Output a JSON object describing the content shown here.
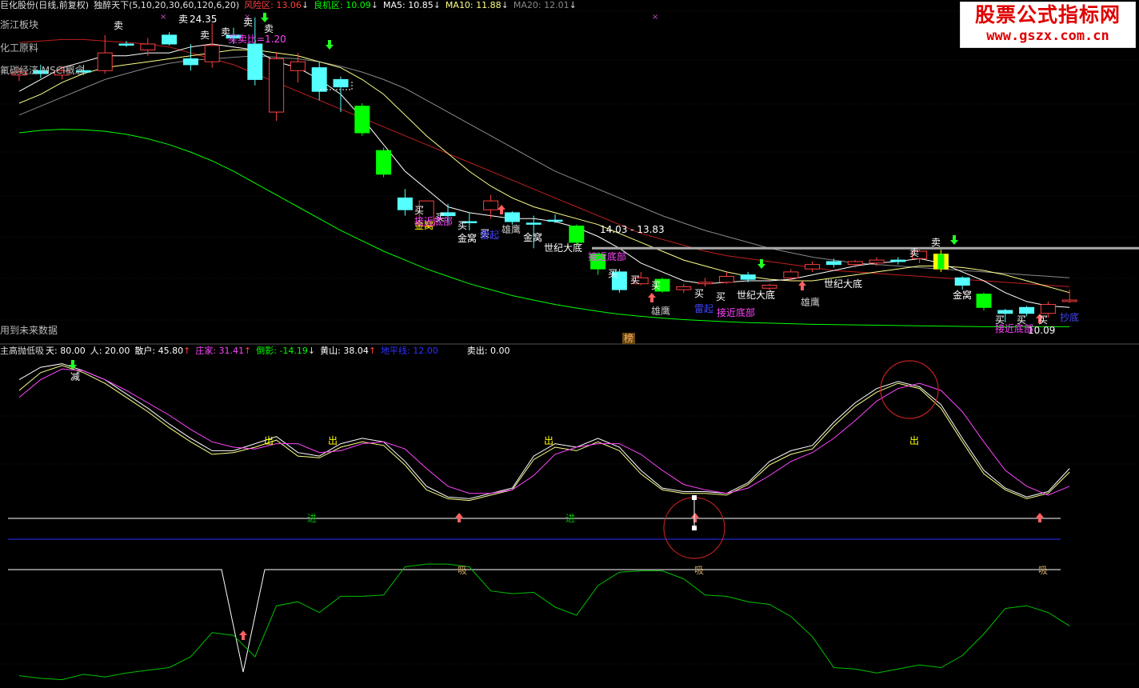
{
  "header_main": {
    "title": "巨化股份(日线,前复权)",
    "indicator": "独醉天下(5,10,20,30,60,120,6,20)",
    "risk_label": "风险区: 13.06",
    "chance_label": "良机区: 10.09",
    "ma5": "MA5: 10.85",
    "ma10": "MA10: 11.88",
    "ma20": "MA20: 12.01",
    "down_arrow": "↓"
  },
  "sidebar": {
    "items": [
      "浙江板块",
      "化工原料",
      "氟碳经济 MSCI概念"
    ],
    "future_data": "用到未来数据"
  },
  "logo": {
    "cn": "股票公式指标网",
    "url": "www.gszx.com.cn"
  },
  "header_sub": {
    "name": "主高抛低吸",
    "tian": "天: 80.00",
    "ren": "人: 20.00",
    "sanhu": "散户: 45.80",
    "zhuangjia": "庄家: 31.41",
    "daoying": "倒影: -14.19",
    "huangshan": "黄山: 38.04",
    "dipingxian": "地平线: 12.00",
    "maichu": "卖出: 0.00",
    "up_arrow": "↑",
    "down_arrow": "↓"
  },
  "main_labels": {
    "high_price": "24.35",
    "buy_ratio": "买卖比=1.20",
    "range": "14.03 - 13.83",
    "last_price": "10.09",
    "bang": "榜"
  },
  "signals": {
    "mai_chu": "卖",
    "mai_ru": "买",
    "jin_wo": "金窝",
    "jie_jin_di_bu": "接近底部",
    "xiong_ying": "雄鹰",
    "shi_ji_da_di": "世纪大底",
    "lei_qi": "雷起",
    "jian": "减",
    "chu": "出",
    "jin": "进",
    "xi": "吸",
    "zhao_zhong": "抄底"
  },
  "colors": {
    "background": "#000000",
    "up_candle": "#ff4040",
    "down_cyan": "#55ffff",
    "down_green": "#00ff00",
    "risk": "#ff4040",
    "chance": "#00ff00",
    "ma20": "#888888",
    "magenta": "#ff44ff",
    "horizon": "#3030ff"
  },
  "chart_data": [
    {
      "type": "candlestick",
      "title": "巨化股份(日线,前复权)",
      "candles": [
        {
          "o": 11.95,
          "c": 12.05,
          "h": 12.2,
          "l": 11.75,
          "col": "red"
        },
        {
          "o": 12.1,
          "c": 12.0,
          "h": 12.3,
          "l": 11.85,
          "col": "cyan"
        },
        {
          "o": 11.95,
          "c": 12.1,
          "h": 12.25,
          "l": 11.8,
          "col": "red"
        },
        {
          "o": 12.05,
          "c": 12.1,
          "h": 12.3,
          "l": 11.95,
          "col": "cyan"
        },
        {
          "o": 12.1,
          "c": 12.7,
          "h": 13.3,
          "l": 12.0,
          "col": "red"
        },
        {
          "o": 13.0,
          "c": 13.0,
          "h": 13.1,
          "l": 12.9,
          "col": "cyan"
        },
        {
          "o": 12.8,
          "c": 13.0,
          "h": 13.2,
          "l": 12.6,
          "col": "red"
        },
        {
          "o": 13.3,
          "c": 13.0,
          "h": 13.4,
          "l": 12.95,
          "col": "cyan"
        },
        {
          "o": 12.5,
          "c": 12.3,
          "h": 13.0,
          "l": 12.1,
          "col": "cyan"
        },
        {
          "o": 12.4,
          "c": 12.95,
          "h": 13.7,
          "l": 12.2,
          "col": "red"
        },
        {
          "o": 13.3,
          "c": 13.2,
          "h": 13.55,
          "l": 13.0,
          "col": "cyan"
        },
        {
          "o": 13.0,
          "c": 11.8,
          "h": 13.9,
          "l": 11.6,
          "col": "cyan"
        },
        {
          "o": 10.7,
          "c": 12.5,
          "h": 12.7,
          "l": 10.4,
          "col": "red"
        },
        {
          "o": 12.4,
          "c": 12.1,
          "h": 12.7,
          "l": 11.7,
          "col": "red"
        },
        {
          "o": 12.2,
          "c": 11.4,
          "h": 12.4,
          "l": 11.1,
          "col": "cyan"
        },
        {
          "o": 11.8,
          "c": 11.55,
          "h": 11.9,
          "l": 10.7,
          "col": "cyan"
        },
        {
          "o": 10.9,
          "c": 10.0,
          "h": 11.0,
          "l": 9.9,
          "col": "green"
        },
        {
          "o": 9.4,
          "c": 8.6,
          "h": 9.5,
          "l": 8.5,
          "col": "green"
        },
        {
          "o": 7.8,
          "c": 7.4,
          "h": 8.1,
          "l": 7.2,
          "col": "cyan"
        },
        {
          "o": 6.85,
          "c": 7.7,
          "h": 7.7,
          "l": 6.8,
          "col": "red"
        },
        {
          "o": 7.3,
          "c": 7.2,
          "h": 7.6,
          "l": 6.9,
          "col": "cyan"
        },
        {
          "o": 7.0,
          "c": 7.0,
          "h": 7.3,
          "l": 6.7,
          "col": "cyan"
        },
        {
          "o": 7.4,
          "c": 7.7,
          "h": 7.9,
          "l": 7.1,
          "col": "red"
        },
        {
          "o": 7.3,
          "c": 7.0,
          "h": 7.35,
          "l": 6.9,
          "col": "cyan"
        },
        {
          "o": 6.95,
          "c": 6.95,
          "h": 7.2,
          "l": 6.1,
          "col": "cyan"
        },
        {
          "o": 7.05,
          "c": 7.05,
          "h": 7.25,
          "l": 6.95,
          "col": "cyan"
        },
        {
          "o": 6.85,
          "c": 6.3,
          "h": 6.9,
          "l": 6.2,
          "col": "green"
        },
        {
          "o": 5.9,
          "c": 5.4,
          "h": 5.95,
          "l": 5.2,
          "col": "green"
        },
        {
          "o": 5.3,
          "c": 4.7,
          "h": 5.4,
          "l": 4.6,
          "col": "cyan"
        },
        {
          "o": 4.9,
          "c": 5.1,
          "h": 5.3,
          "l": 4.85,
          "col": "red"
        },
        {
          "o": 5.05,
          "c": 4.65,
          "h": 5.1,
          "l": 4.6,
          "col": "green"
        },
        {
          "o": 4.7,
          "c": 4.8,
          "h": 4.9,
          "l": 4.6,
          "col": "red"
        },
        {
          "o": 4.9,
          "c": 4.95,
          "h": 5.1,
          "l": 4.8,
          "col": "red"
        },
        {
          "o": 4.95,
          "c": 5.15,
          "h": 5.3,
          "l": 4.9,
          "col": "red"
        },
        {
          "o": 5.2,
          "c": 5.05,
          "h": 5.3,
          "l": 4.95,
          "col": "cyan"
        },
        {
          "o": 4.85,
          "c": 4.75,
          "h": 4.9,
          "l": 4.65,
          "col": "red"
        },
        {
          "o": 5.1,
          "c": 5.3,
          "h": 5.4,
          "l": 5.0,
          "col": "red"
        },
        {
          "o": 5.4,
          "c": 5.55,
          "h": 5.65,
          "l": 5.3,
          "col": "red"
        },
        {
          "o": 5.55,
          "c": 5.65,
          "h": 5.75,
          "l": 5.45,
          "col": "cyan"
        },
        {
          "o": 5.55,
          "c": 5.65,
          "h": 5.7,
          "l": 5.45,
          "col": "red"
        },
        {
          "o": 5.6,
          "c": 5.7,
          "h": 5.8,
          "l": 5.5,
          "col": "red"
        },
        {
          "o": 5.65,
          "c": 5.7,
          "h": 5.8,
          "l": 5.55,
          "col": "cyan"
        },
        {
          "o": 5.75,
          "c": 6.0,
          "h": 6.1,
          "l": 5.6,
          "col": "red"
        },
        {
          "o": 5.9,
          "c": 5.4,
          "h": 6.05,
          "l": 5.3,
          "col": "yellowgreen"
        },
        {
          "o": 5.1,
          "c": 4.85,
          "h": 5.15,
          "l": 4.7,
          "col": "cyan"
        },
        {
          "o": 4.55,
          "c": 4.1,
          "h": 4.6,
          "l": 4.0,
          "col": "green"
        },
        {
          "o": 4.0,
          "c": 3.9,
          "h": 4.05,
          "l": 3.6,
          "col": "cyan"
        },
        {
          "o": 4.1,
          "c": 3.9,
          "h": 4.15,
          "l": 3.8,
          "col": "cyan"
        },
        {
          "o": 3.9,
          "c": 4.2,
          "h": 4.3,
          "l": 3.75,
          "col": "red"
        },
        {
          "o": 4.3,
          "c": 4.35,
          "h": 4.7,
          "l": 4.25,
          "col": "red"
        }
      ],
      "ma5": [
        11.4,
        11.8,
        12.2,
        12.4,
        12.6,
        12.6,
        12.7,
        12.7,
        12.9,
        13.0,
        12.9,
        12.8,
        12.4,
        12.2,
        11.8,
        11.3,
        10.5,
        9.6,
        8.7,
        8.1,
        7.5,
        7.3,
        7.2,
        7.1,
        7.1,
        7.0,
        6.8,
        6.5,
        6.1,
        5.6,
        5.3,
        5.0,
        4.9,
        4.95,
        5.0,
        5.0,
        5.05,
        5.2,
        5.35,
        5.5,
        5.6,
        5.65,
        5.75,
        5.6,
        5.3,
        5.0,
        4.6,
        4.3,
        4.15,
        4.1
      ],
      "ma10": [
        11.0,
        11.3,
        11.7,
        12.0,
        12.2,
        12.3,
        12.4,
        12.5,
        12.6,
        12.7,
        12.8,
        12.8,
        12.7,
        12.6,
        12.4,
        12.2,
        11.8,
        11.3,
        10.6,
        9.9,
        9.3,
        8.7,
        8.2,
        7.8,
        7.5,
        7.3,
        7.1,
        6.9,
        6.6,
        6.3,
        6.0,
        5.7,
        5.5,
        5.3,
        5.15,
        5.05,
        5.0,
        5.0,
        5.1,
        5.2,
        5.3,
        5.4,
        5.5,
        5.5,
        5.45,
        5.35,
        5.2,
        5.0,
        4.8,
        4.6
      ],
      "ma20": [
        10.6,
        10.9,
        11.2,
        11.5,
        11.8,
        12.0,
        12.2,
        12.35,
        12.45,
        12.5,
        12.55,
        12.6,
        12.55,
        12.5,
        12.4,
        12.25,
        12.05,
        11.8,
        11.5,
        11.1,
        10.7,
        10.3,
        9.9,
        9.5,
        9.1,
        8.7,
        8.4,
        8.1,
        7.8,
        7.5,
        7.2,
        6.95,
        6.7,
        6.5,
        6.3,
        6.1,
        5.95,
        5.8,
        5.7,
        5.6,
        5.55,
        5.5,
        5.45,
        5.4,
        5.35,
        5.3,
        5.25,
        5.2,
        5.15,
        5.1
      ],
      "risk_line": [
        13.05,
        13.1,
        13.15,
        13.15,
        13.1,
        13.05,
        13.0,
        12.9,
        12.7,
        12.5,
        12.3,
        12.0,
        11.7,
        11.4,
        11.1,
        10.8,
        10.5,
        10.2,
        9.9,
        9.6,
        9.3,
        9.0,
        8.7,
        8.4,
        8.1,
        7.8,
        7.5,
        7.2,
        6.9,
        6.6,
        6.4,
        6.2,
        6.0,
        5.85,
        5.75,
        5.65,
        5.55,
        5.45,
        5.35,
        5.3,
        5.25,
        5.2,
        5.15,
        5.1,
        5.05,
        5.0,
        4.95,
        4.9,
        4.85,
        4.8
      ],
      "chance_line": [
        10.0,
        10.08,
        10.12,
        10.1,
        10.05,
        9.95,
        9.8,
        9.6,
        9.35,
        9.05,
        8.7,
        8.3,
        7.9,
        7.5,
        7.1,
        6.7,
        6.35,
        6.0,
        5.7,
        5.4,
        5.15,
        4.9,
        4.7,
        4.5,
        4.35,
        4.2,
        4.08,
        3.97,
        3.87,
        3.8,
        3.74,
        3.69,
        3.65,
        3.62,
        3.59,
        3.57,
        3.55,
        3.53,
        3.52,
        3.51,
        3.5,
        3.49,
        3.48,
        3.47,
        3.46,
        3.45,
        3.45,
        3.45,
        3.45,
        3.45
      ],
      "price_ylim": [
        3.0,
        14.0
      ]
    },
    {
      "type": "line",
      "title": "主高抛低吸",
      "ylim": [
        0,
        100
      ],
      "horizontal_lines": [
        80,
        45.8,
        31.4
      ],
      "series": [
        {
          "name": "散户",
          "color": "#ffffff",
          "values": [
            88,
            95,
            97,
            93,
            88,
            80,
            72,
            63,
            55,
            48,
            48,
            52,
            56,
            47,
            45,
            52,
            55,
            53,
            42,
            28,
            22,
            21,
            24,
            27,
            45,
            52,
            50,
            55,
            50,
            37,
            27,
            25,
            25,
            24,
            30,
            42,
            48,
            51,
            64,
            75,
            83,
            87,
            84,
            74,
            55,
            37,
            27,
            22,
            25,
            38
          ]
        },
        {
          "name": "庄家",
          "color": "#ffff88",
          "values": [
            82,
            92,
            96,
            92,
            86,
            78,
            70,
            61,
            53,
            46,
            47,
            50,
            54,
            45,
            44,
            50,
            53,
            51,
            40,
            26,
            21,
            20,
            23,
            26,
            43,
            50,
            48,
            53,
            48,
            35,
            26,
            24,
            24,
            23,
            29,
            40,
            46,
            49,
            62,
            73,
            81,
            86,
            83,
            72,
            53,
            35,
            26,
            21,
            24,
            36
          ]
        },
        {
          "name": "倒影",
          "color": "#ff44ff",
          "values": [
            78,
            88,
            94,
            93,
            88,
            82,
            75,
            68,
            60,
            53,
            50,
            49,
            52,
            52,
            47,
            48,
            52,
            53,
            49,
            38,
            28,
            24,
            24,
            26,
            34,
            46,
            50,
            52,
            52,
            46,
            37,
            29,
            26,
            24,
            27,
            34,
            42,
            47,
            55,
            65,
            76,
            83,
            86,
            82,
            70,
            53,
            37,
            28,
            23,
            28
          ]
        }
      ]
    },
    {
      "type": "line",
      "title": "黄山",
      "ylim": [
        0,
        100
      ],
      "series": [
        {
          "name": "黄山",
          "color": "#00c000",
          "values": [
            8,
            6,
            5,
            9,
            7,
            10,
            12,
            14,
            22,
            40,
            38,
            22,
            60,
            63,
            55,
            67,
            67,
            68,
            89,
            91,
            91,
            89,
            71,
            69,
            70,
            59,
            53,
            75,
            85,
            86,
            86,
            80,
            68,
            67,
            63,
            61,
            52,
            37,
            14,
            13,
            10,
            13,
            16,
            14,
            23,
            39,
            58,
            60,
            55,
            45
          ]
        }
      ]
    }
  ]
}
